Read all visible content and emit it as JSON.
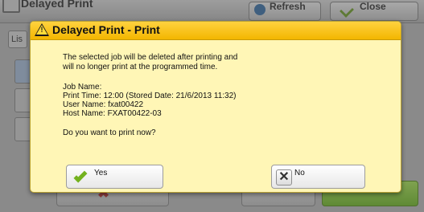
{
  "background": {
    "screen_title": "Delayed Print",
    "refresh_label": "Refresh",
    "close_label": "Close",
    "list_tab_label": "Lis"
  },
  "dialog": {
    "title": "Delayed Print - Print",
    "warning_icon": "warning-icon",
    "message_line1": "The selected job will be deleted after printing and",
    "message_line2": "will no longer print at the programmed time.",
    "job_name": "Job Name:",
    "print_time": "Print Time: 12:00 (Stored Date: 21/6/2013 11:32)",
    "user_name": "User Name: fxat00422",
    "host_name": "Host Name: FXAT00422-03",
    "question": "Do you want to print now?",
    "yes_label": "Yes",
    "no_label": "No"
  },
  "colors": {
    "dialog_bg": "#fff6b6",
    "titlebar": "#f3b600",
    "check": "#74b21e"
  }
}
